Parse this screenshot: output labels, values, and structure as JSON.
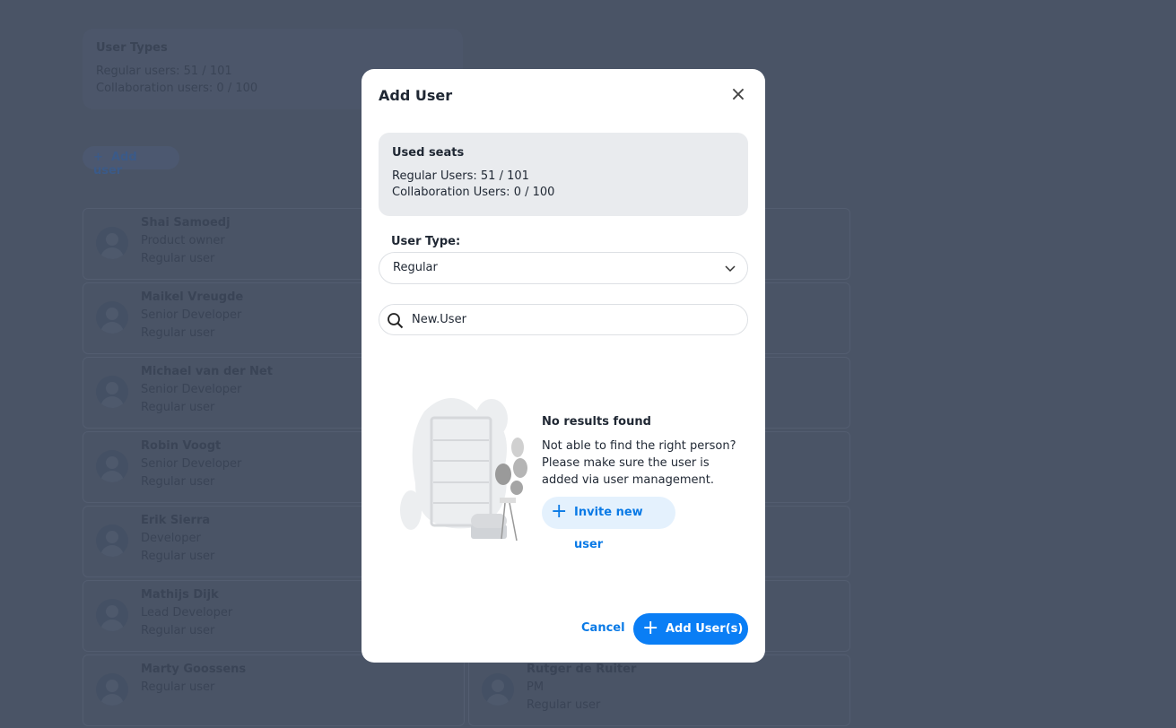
{
  "background": {
    "user_types": {
      "title": "User Types",
      "regular": "Regular users: 51 / 101",
      "collab": "Collaboration users: 0 / 100"
    },
    "add_user_label": "Add user",
    "left_users": [
      {
        "name": "Shai Samoedj",
        "role": "Product owner",
        "type": "Regular user"
      },
      {
        "name": "Maikel Vreugde",
        "role": "Senior Developer",
        "type": "Regular user"
      },
      {
        "name": "Michael van der Net",
        "role": "Senior Developer",
        "type": "Regular user"
      },
      {
        "name": "Robin Voogt",
        "role": "Senior Developer",
        "type": "Regular user"
      },
      {
        "name": "Erik Sierra",
        "role": "Developer",
        "type": "Regular user"
      },
      {
        "name": "Mathijs Dijk",
        "role": "Lead Developer",
        "type": "Regular user"
      },
      {
        "name": "Marty Goossens",
        "role": "Regular user",
        "type": ""
      }
    ],
    "right_users": [
      {
        "name": "Rutger de Ruiter",
        "role": "PM",
        "type": "Regular user"
      }
    ]
  },
  "modal": {
    "title": "Add User",
    "seats": {
      "title": "Used seats",
      "regular": "Regular Users: 51 / 101",
      "collab": "Collaboration Users: 0 / 100"
    },
    "user_type_label": "User Type:",
    "user_type_value": "Regular",
    "search_value": "New.User",
    "empty": {
      "title": "No results found",
      "line1": "Not able to find the right person?",
      "line2": "Please make sure the user is",
      "line3": "added via user management."
    },
    "invite_label": "Invite new user",
    "cancel_label": "Cancel",
    "add_label": "Add User(s)",
    "accent": "#0a7ef5"
  }
}
